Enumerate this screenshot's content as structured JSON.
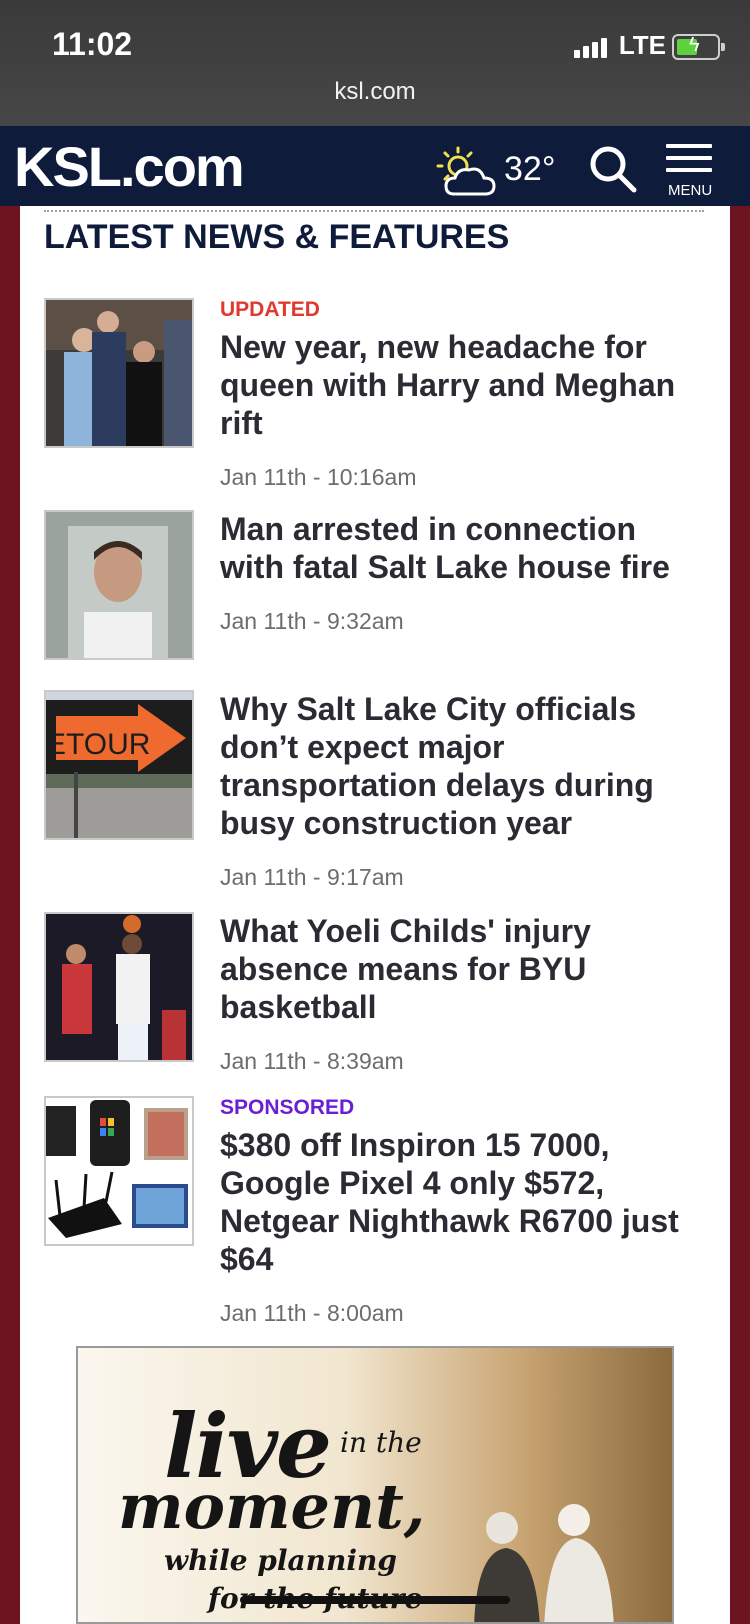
{
  "status_bar": {
    "time": "11:02",
    "network": "LTE",
    "url": "ksl.com"
  },
  "header": {
    "logo": "KSL.com",
    "temperature": "32°",
    "weather_icon": "partly-sunny-icon",
    "search_icon": "search-icon",
    "menu_label": "MENU"
  },
  "section": {
    "title": "LATEST NEWS & FEATURES"
  },
  "articles": [
    {
      "tag": "UPDATED",
      "headline": "New year, new headache for queen with Harry and Meghan rift",
      "date": "Jan 11th - 10:16am"
    },
    {
      "tag": "",
      "headline": "Man arrested in connection with fatal Salt Lake house fire",
      "date": "Jan 11th - 9:32am"
    },
    {
      "tag": "",
      "headline": "Why Salt Lake City officials don’t expect major transportation delays during busy construction year",
      "date": "Jan 11th - 9:17am"
    },
    {
      "tag": "",
      "headline": "What Yoeli Childs' injury absence means for BYU basketball",
      "date": "Jan 11th - 8:39am"
    },
    {
      "tag": "SPONSORED",
      "headline": "$380 off Inspiron 15 7000, Google Pixel 4 only $572, Netgear Nighthawk R6700 just $64",
      "date": "Jan 11th - 8:00am"
    }
  ],
  "ad": {
    "line1": "live",
    "line1b": "in the",
    "line2": "moment,",
    "line3": "while planning",
    "line4": "for the future"
  },
  "thumb_labels": {
    "detour": "ETOUR"
  },
  "colors": {
    "header_bg": "#0f1b3a",
    "page_bg": "#6d1420",
    "updated": "#e03a2f",
    "sponsored": "#6b1fd2"
  }
}
